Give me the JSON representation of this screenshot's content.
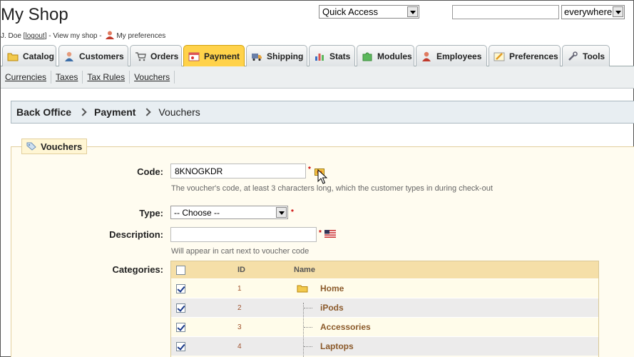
{
  "header": {
    "shop_title": "My Shop",
    "user_name": "J. Doe [",
    "logout_label": "logout",
    "view_shop": "] - View my shop -",
    "preferences_label": "My preferences",
    "quick_access": "Quick Access",
    "search_value": "",
    "search_scope": "everywhere"
  },
  "tabs": [
    {
      "label": "Catalog",
      "icon": "folder-icon",
      "active": false
    },
    {
      "label": "Customers",
      "icon": "customer-icon",
      "active": false
    },
    {
      "label": "Orders",
      "icon": "cart-icon",
      "active": false
    },
    {
      "label": "Payment",
      "icon": "payment-icon",
      "active": true
    },
    {
      "label": "Shipping",
      "icon": "truck-icon",
      "active": false
    },
    {
      "label": "Stats",
      "icon": "chart-icon",
      "active": false
    },
    {
      "label": "Modules",
      "icon": "puzzle-icon",
      "active": false
    },
    {
      "label": "Employees",
      "icon": "employee-icon",
      "active": false
    },
    {
      "label": "Preferences",
      "icon": "preferences-icon",
      "active": false
    },
    {
      "label": "Tools",
      "icon": "wrench-icon",
      "active": false
    }
  ],
  "subnav": [
    "Currencies",
    "Taxes",
    "Tax Rules",
    "Vouchers"
  ],
  "breadcrumb": [
    "Back Office",
    "Payment",
    "Vouchers"
  ],
  "form": {
    "legend": "Vouchers",
    "code_label": "Code:",
    "code_value": "8KNOGKDR",
    "code_hint": "The voucher's code, at least 3 characters long, which the customer types in during check-out",
    "type_label": "Type:",
    "type_value": "-- Choose --",
    "description_label": "Description:",
    "description_value": "",
    "description_hint": "Will appear in cart next to voucher code",
    "categories_label": "Categories:",
    "required_mark": "*"
  },
  "categories": {
    "columns": [
      "",
      "ID",
      "Name"
    ],
    "header_checked": false,
    "rows": [
      {
        "id": "1",
        "name": "Home",
        "checked": true
      },
      {
        "id": "2",
        "name": "iPods",
        "checked": true
      },
      {
        "id": "3",
        "name": "Accessories",
        "checked": true
      },
      {
        "id": "4",
        "name": "Laptops",
        "checked": true
      }
    ]
  },
  "colors": {
    "active_tab": "#ffd24a",
    "fieldset_bg": "#fffcf0",
    "table_header": "#f5dfa8",
    "category_link": "#8b5a2b"
  }
}
